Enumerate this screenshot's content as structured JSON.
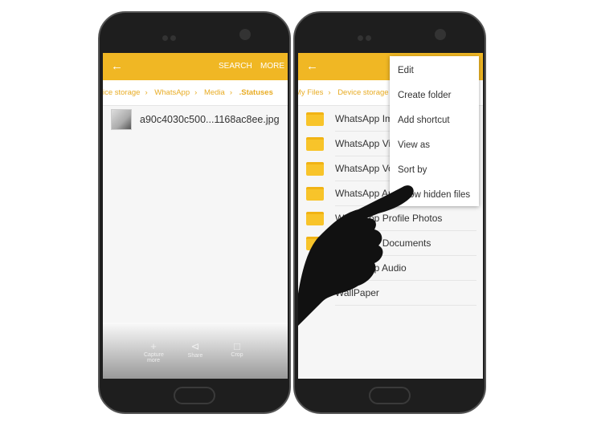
{
  "left_phone": {
    "appbar": {
      "back_icon": "arrow-left-icon",
      "search": "SEARCH",
      "more": "MORE"
    },
    "breadcrumb": [
      "ice storage",
      "WhatsApp",
      "Media",
      ".Statuses"
    ],
    "file": {
      "name": "a90c4030c500...1168ac8ee.jpg"
    },
    "bottom_bar": [
      {
        "icon": "plus-icon",
        "label": "Capture more"
      },
      {
        "icon": "share-icon",
        "label": "Share"
      },
      {
        "icon": "crop-icon",
        "label": "Crop"
      }
    ]
  },
  "right_phone": {
    "appbar": {
      "back_icon": "arrow-left-icon"
    },
    "breadcrumb": [
      "My Files",
      "Device storage"
    ],
    "folders": [
      "WhatsApp Images",
      "WhatsApp Video",
      "WhatsApp Voice Notes",
      "WhatsApp Animated Gifs",
      "WhatsApp Profile Photos",
      "WhatsApp Documents",
      "WhatsApp Audio",
      "WallPaper"
    ],
    "menu": [
      "Edit",
      "Create folder",
      "Add shortcut",
      "View as",
      "Sort by",
      "Show hidden files"
    ]
  },
  "colors": {
    "accent": "#f0b724",
    "folder": "#f8c42a"
  }
}
